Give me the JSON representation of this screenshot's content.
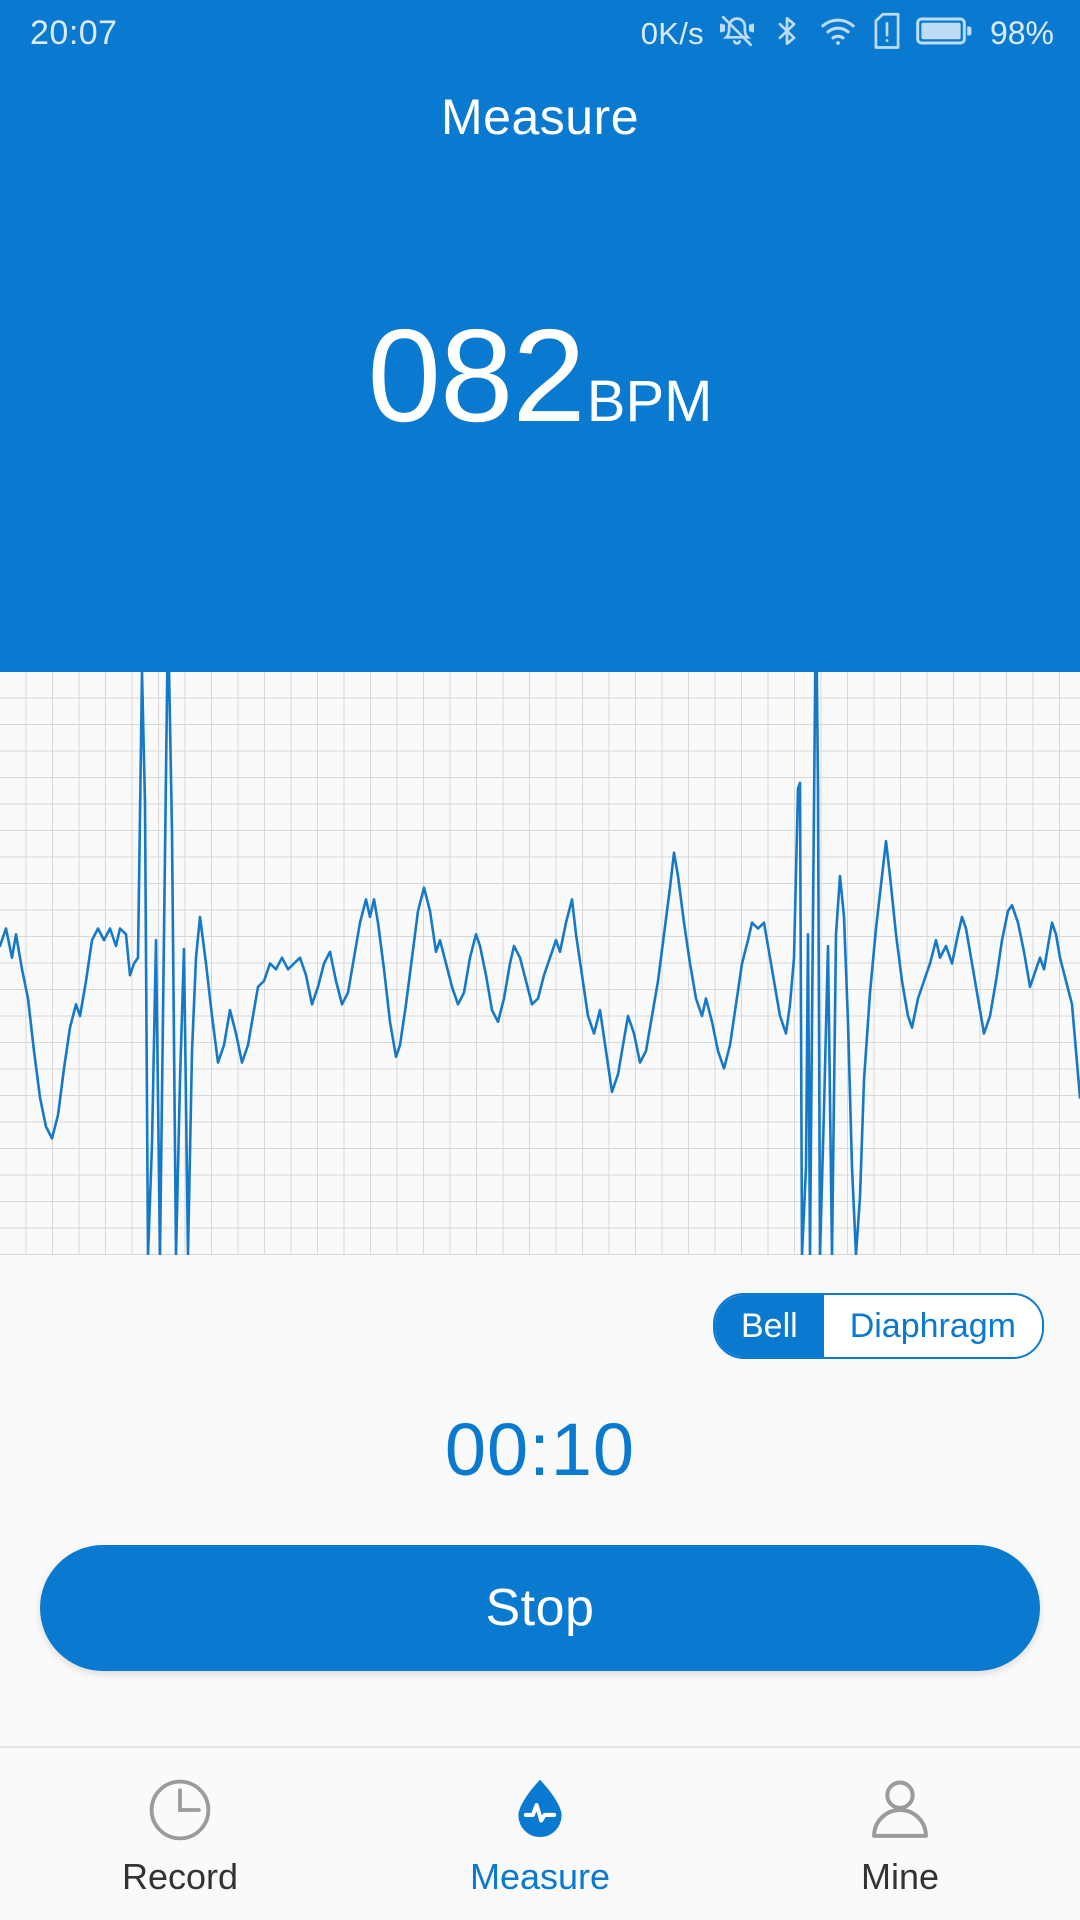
{
  "statusbar": {
    "time": "20:07",
    "network_speed": "0K/s",
    "battery_percent": "98%",
    "icons": [
      {
        "name": "mute-bell-icon",
        "label": "silent mode"
      },
      {
        "name": "bluetooth-icon",
        "label": "bluetooth"
      },
      {
        "name": "wifi-icon",
        "label": "wifi"
      },
      {
        "name": "sim-alert-icon",
        "label": "no sim"
      },
      {
        "name": "battery-icon",
        "label": "battery"
      }
    ]
  },
  "header": {
    "title": "Measure",
    "bpm_value": "082",
    "bpm_unit": "BPM",
    "background_color": "#0a79d0"
  },
  "chart_data": {
    "type": "line",
    "title": "",
    "xlabel": "",
    "ylabel": "",
    "grid": true,
    "grid_color": "#d8d8d8",
    "line_color": "#1579c8",
    "background_color": "#fafafa",
    "ylim": [
      -1,
      1
    ],
    "xlim": [
      0,
      1080
    ],
    "series": [
      {
        "name": "phonocardiogram",
        "points": [
          [
            0,
            0.06
          ],
          [
            6,
            0.12
          ],
          [
            12,
            0.02
          ],
          [
            16,
            0.1
          ],
          [
            22,
            -0.02
          ],
          [
            28,
            -0.12
          ],
          [
            34,
            -0.3
          ],
          [
            40,
            -0.46
          ],
          [
            46,
            -0.56
          ],
          [
            52,
            -0.6
          ],
          [
            58,
            -0.52
          ],
          [
            64,
            -0.36
          ],
          [
            70,
            -0.22
          ],
          [
            76,
            -0.14
          ],
          [
            80,
            -0.18
          ],
          [
            86,
            -0.06
          ],
          [
            92,
            0.08
          ],
          [
            98,
            0.12
          ],
          [
            104,
            0.08
          ],
          [
            110,
            0.12
          ],
          [
            116,
            0.06
          ],
          [
            120,
            0.12
          ],
          [
            126,
            0.1
          ],
          [
            130,
            -0.04
          ],
          [
            134,
            0.0
          ],
          [
            138,
            0.02
          ],
          [
            142,
            1.0
          ],
          [
            145,
            0.55
          ],
          [
            148,
            -1.0
          ],
          [
            152,
            -0.62
          ],
          [
            156,
            0.08
          ],
          [
            160,
            -1.0
          ],
          [
            164,
            0.1
          ],
          [
            168,
            1.2
          ],
          [
            172,
            0.45
          ],
          [
            176,
            -1.0
          ],
          [
            180,
            -0.4
          ],
          [
            184,
            0.05
          ],
          [
            188,
            -1.0
          ],
          [
            192,
            -0.3
          ],
          [
            196,
            0.02
          ],
          [
            200,
            0.16
          ],
          [
            206,
            0.0
          ],
          [
            212,
            -0.18
          ],
          [
            218,
            -0.34
          ],
          [
            224,
            -0.28
          ],
          [
            230,
            -0.16
          ],
          [
            236,
            -0.24
          ],
          [
            242,
            -0.34
          ],
          [
            248,
            -0.28
          ],
          [
            254,
            -0.16
          ],
          [
            258,
            -0.08
          ],
          [
            264,
            -0.06
          ],
          [
            270,
            0.0
          ],
          [
            276,
            -0.02
          ],
          [
            282,
            0.02
          ],
          [
            288,
            -0.02
          ],
          [
            294,
            0.0
          ],
          [
            300,
            0.02
          ],
          [
            306,
            -0.04
          ],
          [
            312,
            -0.14
          ],
          [
            318,
            -0.08
          ],
          [
            324,
            0.0
          ],
          [
            330,
            0.04
          ],
          [
            336,
            -0.06
          ],
          [
            342,
            -0.14
          ],
          [
            348,
            -0.1
          ],
          [
            354,
            0.02
          ],
          [
            360,
            0.14
          ],
          [
            366,
            0.22
          ],
          [
            370,
            0.16
          ],
          [
            374,
            0.22
          ],
          [
            378,
            0.14
          ],
          [
            384,
            -0.02
          ],
          [
            390,
            -0.2
          ],
          [
            396,
            -0.32
          ],
          [
            400,
            -0.28
          ],
          [
            406,
            -0.14
          ],
          [
            412,
            0.02
          ],
          [
            418,
            0.18
          ],
          [
            424,
            0.26
          ],
          [
            430,
            0.18
          ],
          [
            436,
            0.04
          ],
          [
            440,
            0.08
          ],
          [
            446,
            0.0
          ],
          [
            452,
            -0.08
          ],
          [
            458,
            -0.14
          ],
          [
            464,
            -0.1
          ],
          [
            470,
            0.02
          ],
          [
            476,
            0.1
          ],
          [
            480,
            0.06
          ],
          [
            486,
            -0.04
          ],
          [
            492,
            -0.16
          ],
          [
            498,
            -0.2
          ],
          [
            504,
            -0.12
          ],
          [
            510,
            0.0
          ],
          [
            514,
            0.06
          ],
          [
            520,
            0.02
          ],
          [
            526,
            -0.06
          ],
          [
            532,
            -0.14
          ],
          [
            538,
            -0.12
          ],
          [
            544,
            -0.04
          ],
          [
            550,
            0.02
          ],
          [
            556,
            0.08
          ],
          [
            560,
            0.04
          ],
          [
            566,
            0.14
          ],
          [
            572,
            0.22
          ],
          [
            576,
            0.1
          ],
          [
            582,
            -0.04
          ],
          [
            588,
            -0.18
          ],
          [
            594,
            -0.24
          ],
          [
            600,
            -0.16
          ],
          [
            606,
            -0.3
          ],
          [
            612,
            -0.44
          ],
          [
            618,
            -0.38
          ],
          [
            624,
            -0.26
          ],
          [
            628,
            -0.18
          ],
          [
            634,
            -0.24
          ],
          [
            640,
            -0.34
          ],
          [
            646,
            -0.3
          ],
          [
            652,
            -0.18
          ],
          [
            658,
            -0.06
          ],
          [
            664,
            0.1
          ],
          [
            670,
            0.26
          ],
          [
            674,
            0.38
          ],
          [
            678,
            0.3
          ],
          [
            684,
            0.14
          ],
          [
            690,
            0.0
          ],
          [
            696,
            -0.12
          ],
          [
            702,
            -0.18
          ],
          [
            706,
            -0.12
          ],
          [
            712,
            -0.2
          ],
          [
            718,
            -0.3
          ],
          [
            724,
            -0.36
          ],
          [
            730,
            -0.28
          ],
          [
            736,
            -0.14
          ],
          [
            742,
            0.0
          ],
          [
            748,
            0.08
          ],
          [
            752,
            0.14
          ],
          [
            758,
            0.12
          ],
          [
            764,
            0.14
          ],
          [
            768,
            0.06
          ],
          [
            774,
            -0.06
          ],
          [
            780,
            -0.18
          ],
          [
            786,
            -0.24
          ],
          [
            790,
            -0.14
          ],
          [
            794,
            0.02
          ],
          [
            798,
            0.6
          ],
          [
            800,
            0.62
          ],
          [
            802,
            -1.0
          ],
          [
            806,
            -0.7
          ],
          [
            808,
            0.1
          ],
          [
            810,
            -1.0
          ],
          [
            812,
            -0.2
          ],
          [
            816,
            1.28
          ],
          [
            818,
            0.6
          ],
          [
            820,
            -1.0
          ],
          [
            824,
            -0.5
          ],
          [
            828,
            0.06
          ],
          [
            832,
            -1.0
          ],
          [
            836,
            0.1
          ],
          [
            840,
            0.3
          ],
          [
            844,
            0.16
          ],
          [
            848,
            -0.2
          ],
          [
            852,
            -0.7
          ],
          [
            856,
            -1.0
          ],
          [
            860,
            -0.8
          ],
          [
            864,
            -0.4
          ],
          [
            870,
            -0.1
          ],
          [
            876,
            0.12
          ],
          [
            882,
            0.3
          ],
          [
            886,
            0.42
          ],
          [
            890,
            0.3
          ],
          [
            896,
            0.1
          ],
          [
            902,
            -0.06
          ],
          [
            908,
            -0.18
          ],
          [
            912,
            -0.22
          ],
          [
            918,
            -0.12
          ],
          [
            924,
            -0.06
          ],
          [
            930,
            0.0
          ],
          [
            936,
            0.08
          ],
          [
            940,
            0.02
          ],
          [
            946,
            0.06
          ],
          [
            952,
            0.0
          ],
          [
            958,
            0.1
          ],
          [
            962,
            0.16
          ],
          [
            966,
            0.12
          ],
          [
            972,
            0.0
          ],
          [
            978,
            -0.12
          ],
          [
            984,
            -0.24
          ],
          [
            990,
            -0.18
          ],
          [
            996,
            -0.06
          ],
          [
            1002,
            0.08
          ],
          [
            1008,
            0.18
          ],
          [
            1012,
            0.2
          ],
          [
            1018,
            0.14
          ],
          [
            1024,
            0.04
          ],
          [
            1030,
            -0.08
          ],
          [
            1034,
            -0.04
          ],
          [
            1040,
            0.02
          ],
          [
            1044,
            -0.02
          ],
          [
            1048,
            0.06
          ],
          [
            1052,
            0.14
          ],
          [
            1056,
            0.1
          ],
          [
            1060,
            0.02
          ],
          [
            1066,
            -0.06
          ],
          [
            1072,
            -0.14
          ],
          [
            1076,
            -0.3
          ],
          [
            1080,
            -0.46
          ]
        ]
      }
    ]
  },
  "mode_toggle": {
    "options": [
      {
        "label": "Bell",
        "selected": true
      },
      {
        "label": "Diaphragm",
        "selected": false
      }
    ]
  },
  "timer": {
    "elapsed": "00:10"
  },
  "action_button": {
    "label": "Stop",
    "color": "#0a79d0"
  },
  "navbar": {
    "items": [
      {
        "label": "Record",
        "icon": "clock-icon",
        "active": false
      },
      {
        "label": "Measure",
        "icon": "waterdrop-pulse-icon",
        "active": true
      },
      {
        "label": "Mine",
        "icon": "person-icon",
        "active": false
      }
    ],
    "active_color": "#0a79d0",
    "inactive_color": "#8c8c8c"
  }
}
